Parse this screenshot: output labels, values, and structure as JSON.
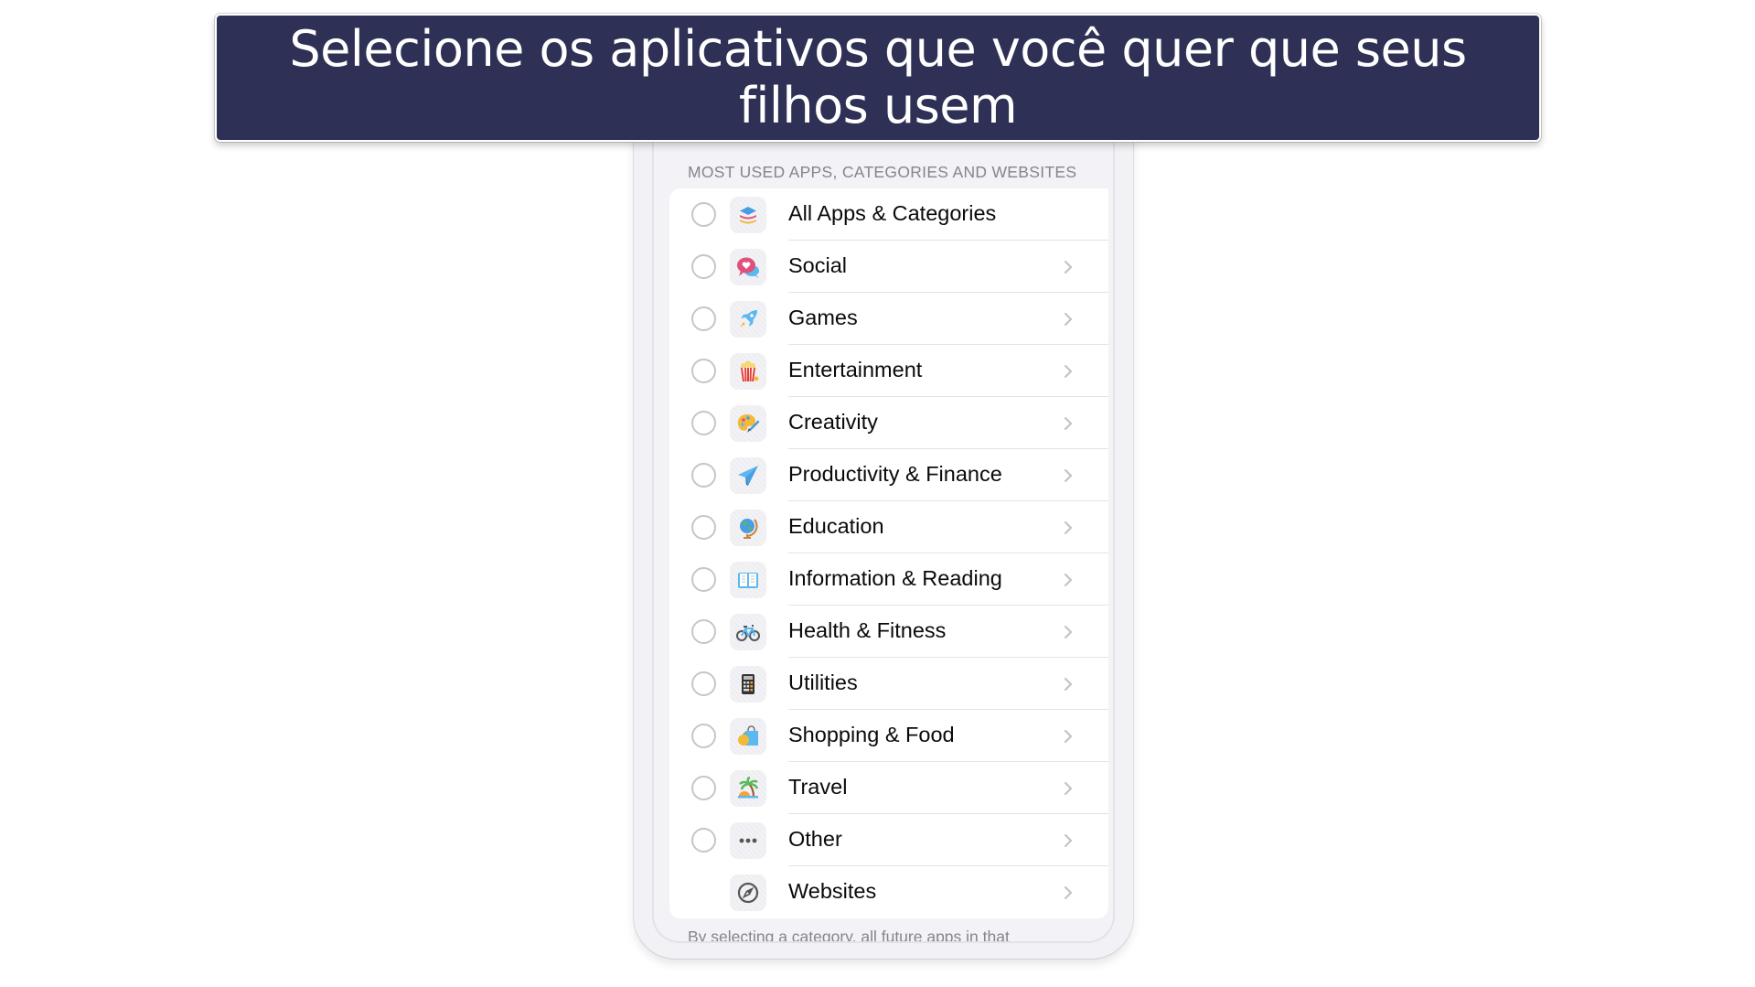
{
  "banner": {
    "title": "Selecione os aplicativos que você quer que seus filhos usem",
    "background_color": "#2e3155",
    "text_color": "#ffffff"
  },
  "screen": {
    "section_header": "MOST USED APPS, CATEGORIES AND WEBSITES",
    "footer_note": "By selecting a category, all future apps in that",
    "categories": [
      {
        "label": "All Apps & Categories",
        "icon": "stack-icon",
        "has_radio": true,
        "has_chevron": false,
        "selected": false
      },
      {
        "label": "Social",
        "icon": "chat-heart-icon",
        "has_radio": true,
        "has_chevron": true,
        "selected": false
      },
      {
        "label": "Games",
        "icon": "rocket-icon",
        "has_radio": true,
        "has_chevron": true,
        "selected": false
      },
      {
        "label": "Entertainment",
        "icon": "popcorn-icon",
        "has_radio": true,
        "has_chevron": true,
        "selected": false
      },
      {
        "label": "Creativity",
        "icon": "palette-icon",
        "has_radio": true,
        "has_chevron": true,
        "selected": false
      },
      {
        "label": "Productivity & Finance",
        "icon": "paper-plane-icon",
        "has_radio": true,
        "has_chevron": true,
        "selected": false
      },
      {
        "label": "Education",
        "icon": "globe-icon",
        "has_radio": true,
        "has_chevron": true,
        "selected": false
      },
      {
        "label": "Information & Reading",
        "icon": "book-icon",
        "has_radio": true,
        "has_chevron": true,
        "selected": false
      },
      {
        "label": "Health & Fitness",
        "icon": "bicycle-icon",
        "has_radio": true,
        "has_chevron": true,
        "selected": false
      },
      {
        "label": "Utilities",
        "icon": "calculator-icon",
        "has_radio": true,
        "has_chevron": true,
        "selected": false
      },
      {
        "label": "Shopping & Food",
        "icon": "shopping-bag-icon",
        "has_radio": true,
        "has_chevron": true,
        "selected": false
      },
      {
        "label": "Travel",
        "icon": "palm-island-icon",
        "has_radio": true,
        "has_chevron": true,
        "selected": false
      },
      {
        "label": "Other",
        "icon": "ellipsis-icon",
        "has_radio": true,
        "has_chevron": true,
        "selected": false
      },
      {
        "label": "Websites",
        "icon": "compass-icon",
        "has_radio": false,
        "has_chevron": true,
        "selected": false
      }
    ]
  }
}
